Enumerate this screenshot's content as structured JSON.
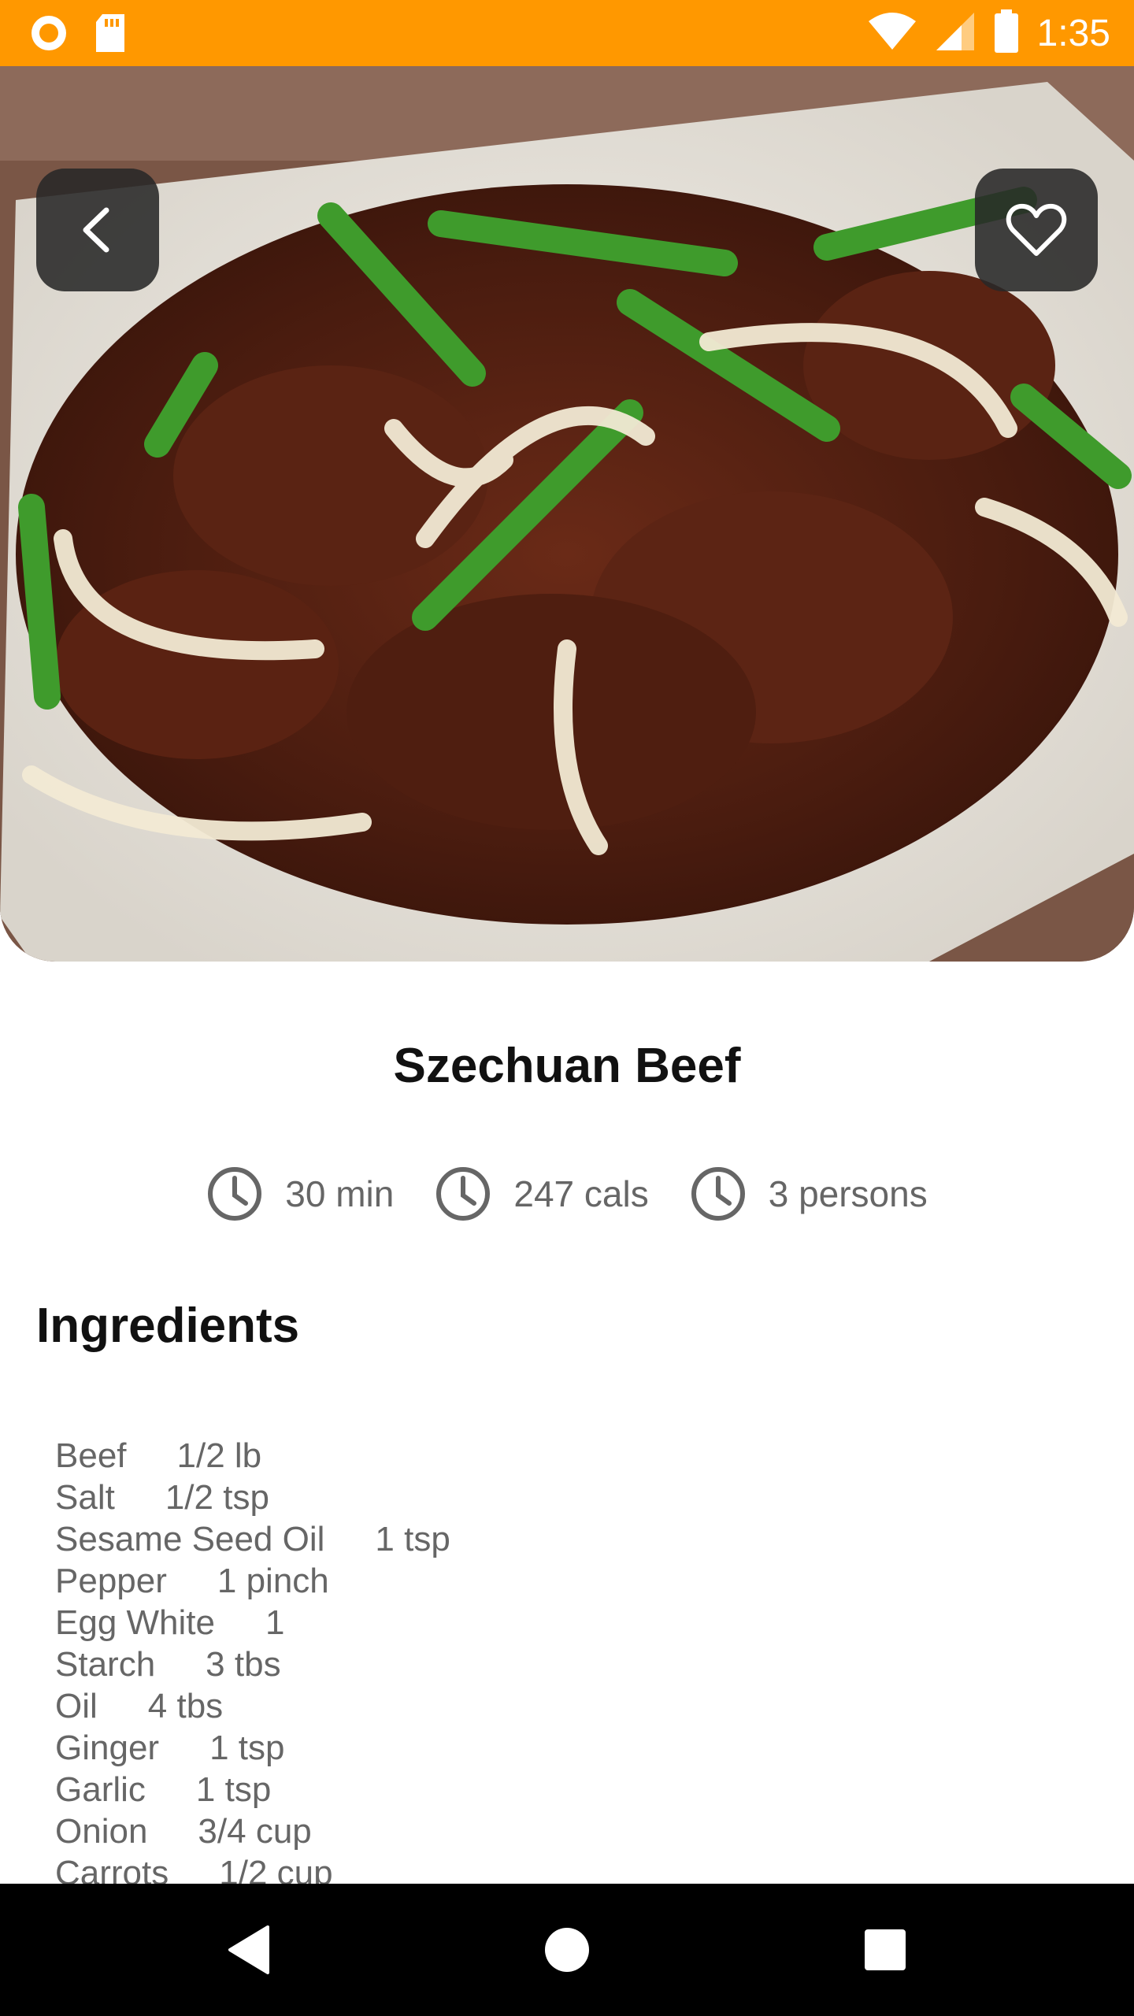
{
  "status_bar": {
    "time": "1:35",
    "icons": [
      "circle-notification-icon",
      "sd-card-icon",
      "wifi-icon",
      "signal-icon",
      "battery-icon"
    ]
  },
  "hero": {
    "image": "szechuan-beef-photo",
    "back_icon": "chevron-left-icon",
    "favorite_icon": "heart-outline-icon"
  },
  "recipe": {
    "title": "Szechuan Beef",
    "stats": [
      {
        "icon": "clock-icon",
        "text": "30 min"
      },
      {
        "icon": "clock-icon",
        "text": "247 cals"
      },
      {
        "icon": "clock-icon",
        "text": "3 persons"
      }
    ]
  },
  "ingredients": {
    "heading": "Ingredients",
    "items": [
      {
        "name": "Beef",
        "qty": "1/2 lb"
      },
      {
        "name": "Salt",
        "qty": "1/2 tsp"
      },
      {
        "name": "Sesame Seed Oil",
        "qty": "1 tsp"
      },
      {
        "name": "Pepper",
        "qty": "1 pinch"
      },
      {
        "name": "Egg White",
        "qty": "1"
      },
      {
        "name": "Starch",
        "qty": "3 tbs"
      },
      {
        "name": "Oil",
        "qty": "4 tbs"
      },
      {
        "name": "Ginger",
        "qty": "1 tsp"
      },
      {
        "name": "Garlic",
        "qty": "1 tsp"
      },
      {
        "name": "Onion",
        "qty": "3/4 cup"
      },
      {
        "name": "Carrots",
        "qty": "1/2 cup"
      }
    ]
  },
  "nav_bar": {
    "icons": [
      "back-triangle-icon",
      "home-circle-icon",
      "recents-square-icon"
    ]
  },
  "colors": {
    "accent": "#ff9800",
    "title": "#111111",
    "muted_text": "#666666"
  }
}
